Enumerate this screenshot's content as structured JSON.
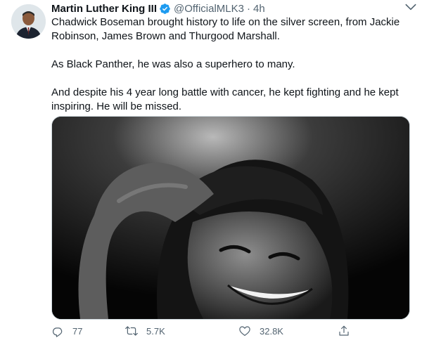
{
  "tweet": {
    "display_name": "Martin Luther King III",
    "handle": "@OfficialMLK3",
    "separator": "·",
    "time": "4h",
    "paragraphs": [
      "Chadwick Boseman brought history to life on the silver screen, from Jackie Robinson, James Brown and Thurgood Marshall.",
      "As Black Panther, he was also a superhero to many.",
      "And despite his 4 year long battle with cancer, he kept fighting and he kept inspiring. He will be missed."
    ]
  },
  "actions": {
    "reply_count": "77",
    "retweet_count": "5.7K",
    "like_count": "32.8K"
  },
  "colors": {
    "verified": "#1d9bf0",
    "secondary_text": "#536471",
    "primary_text": "#0f1419"
  },
  "icons": {
    "verified": "verified-badge-icon",
    "caret": "chevron-down-icon",
    "reply": "reply-icon",
    "retweet": "retweet-icon",
    "like": "heart-icon",
    "share": "share-icon"
  }
}
